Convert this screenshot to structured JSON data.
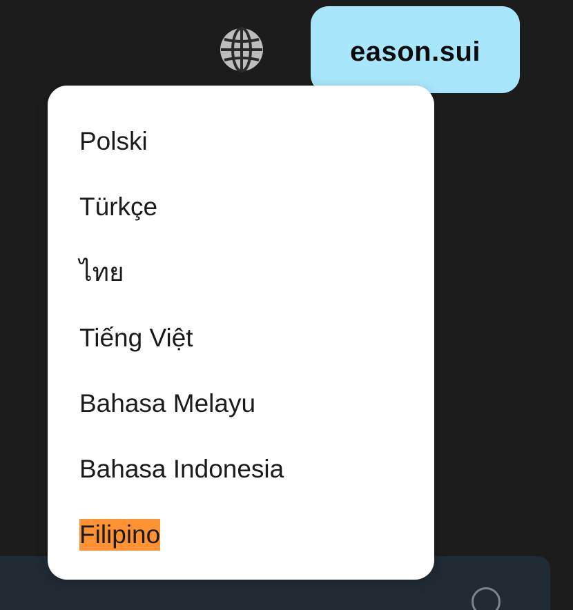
{
  "header": {
    "globe_icon": "globe-icon",
    "username": "eason.sui",
    "user_pill_color": "#a8e6fb"
  },
  "language_menu": {
    "items": [
      {
        "label": "Polski"
      },
      {
        "label": "Türkçe"
      },
      {
        "label": "ไทย"
      },
      {
        "label": "Tiếng Việt"
      },
      {
        "label": "Bahasa Melayu"
      },
      {
        "label": "Bahasa Indonesia"
      },
      {
        "label": "Filipino",
        "highlighted": true
      }
    ],
    "highlight_color": "#ff9233"
  },
  "bottom_panel": {
    "icon": "circle-icon"
  }
}
